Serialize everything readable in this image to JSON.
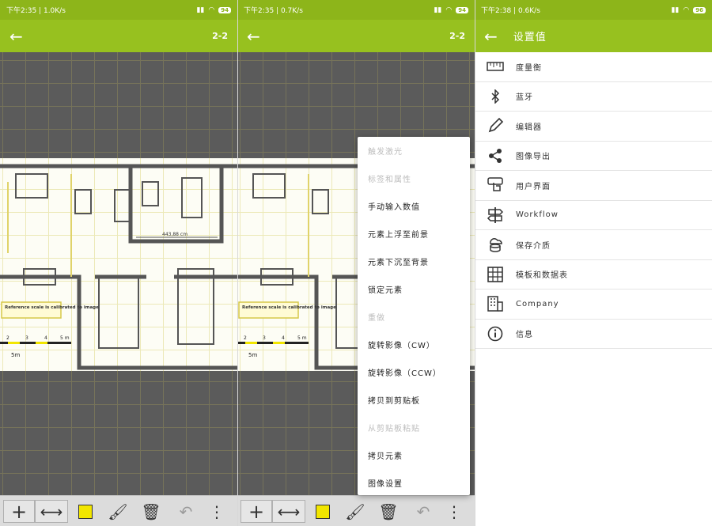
{
  "status_left": [
    "下午2:35 | 1.0K/s",
    "下午2:35 | 0.7K/s",
    "下午2:38 | 0.6K/s"
  ],
  "battery": [
    "94",
    "94",
    "96"
  ],
  "page_indicator": "2-2",
  "settings_title": "设置值",
  "plan_labels": {
    "dimension": "443,88 cm",
    "reference": "Reference scale is calibrated to image",
    "scale_ticks": [
      "2",
      "3",
      "4",
      "5 m"
    ],
    "scale_length": "5m"
  },
  "context_menu": [
    {
      "label": "触发激光",
      "enabled": false
    },
    {
      "label": "标签和属性",
      "enabled": false
    },
    {
      "label": "手动输入数值",
      "enabled": true
    },
    {
      "label": "元素上浮至前景",
      "enabled": true
    },
    {
      "label": "元素下沉至背景",
      "enabled": true
    },
    {
      "label": "锁定元素",
      "enabled": true
    },
    {
      "label": "重做",
      "enabled": false
    },
    {
      "label": "旋转影像（CW）",
      "enabled": true
    },
    {
      "label": "旋转影像（CCW）",
      "enabled": true
    },
    {
      "label": "拷贝到剪贴板",
      "enabled": true
    },
    {
      "label": "从剪贴板粘贴",
      "enabled": false
    },
    {
      "label": "拷贝元素",
      "enabled": true
    },
    {
      "label": "图像设置",
      "enabled": true
    }
  ],
  "settings_items": [
    {
      "label": "度量衡",
      "icon": "ruler-icon"
    },
    {
      "label": "蓝牙",
      "icon": "bluetooth-icon"
    },
    {
      "label": "编辑器",
      "icon": "pencil-icon"
    },
    {
      "label": "图像导出",
      "icon": "share-icon"
    },
    {
      "label": "用户界面",
      "icon": "touch-icon"
    },
    {
      "label": "Workflow",
      "icon": "signpost-icon"
    },
    {
      "label": "保存介质",
      "icon": "cloud-storage-icon"
    },
    {
      "label": "模板和数据表",
      "icon": "table-icon"
    },
    {
      "label": "Company",
      "icon": "company-icon"
    },
    {
      "label": "信息",
      "icon": "info-icon"
    }
  ],
  "colors": {
    "appbar": "#97c11f",
    "statusbar": "#8db51a",
    "swatch": "#f2e600"
  }
}
